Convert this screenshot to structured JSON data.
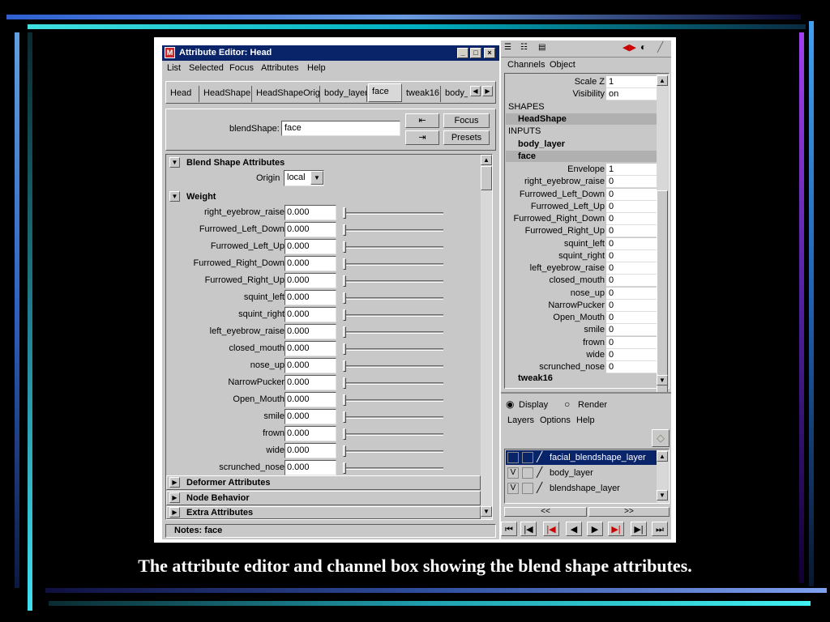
{
  "attribute_editor": {
    "title": "Attribute Editor: Head",
    "menu": [
      "List",
      "Selected",
      "Focus",
      "Attributes",
      "Help"
    ],
    "tabs": [
      "Head",
      "HeadShape",
      "HeadShapeOrig",
      "body_layer",
      "face",
      "tweak16",
      "body_"
    ],
    "active_tab": "face",
    "blendshape_label": "blendShape:",
    "blendshape_value": "face",
    "focus_label": "Focus",
    "presets_label": "Presets",
    "section_blend": "Blend Shape Attributes",
    "origin_label": "Origin",
    "origin_value": "local",
    "section_weight": "Weight",
    "weights": [
      {
        "name": "right_eyebrow_raise",
        "value": "0.000"
      },
      {
        "name": "Furrowed_Left_Down",
        "value": "0.000"
      },
      {
        "name": "Furrowed_Left_Up",
        "value": "0.000"
      },
      {
        "name": "Furrowed_Right_Down",
        "value": "0.000"
      },
      {
        "name": "Furrowed_Right_Up",
        "value": "0.000"
      },
      {
        "name": "squint_left",
        "value": "0.000"
      },
      {
        "name": "squint_right",
        "value": "0.000"
      },
      {
        "name": "left_eyebrow_raise",
        "value": "0.000"
      },
      {
        "name": "closed_mouth",
        "value": "0.000"
      },
      {
        "name": "nose_up",
        "value": "0.000"
      },
      {
        "name": "NarrowPucker",
        "value": "0.000"
      },
      {
        "name": "Open_Mouth",
        "value": "0.000"
      },
      {
        "name": "smile",
        "value": "0.000"
      },
      {
        "name": "frown",
        "value": "0.000"
      },
      {
        "name": "wide",
        "value": "0.000"
      },
      {
        "name": "scrunched_nose",
        "value": "0.000"
      }
    ],
    "section_deformer": "Deformer Attributes",
    "section_node": "Node Behavior",
    "section_extra": "Extra Attributes",
    "notes": "Notes:  face"
  },
  "channel_box": {
    "menu": [
      "Channels",
      "Object"
    ],
    "scale_z": {
      "label": "Scale Z",
      "value": "1"
    },
    "visibility": {
      "label": "Visibility",
      "value": "on"
    },
    "shapes_header": "SHAPES",
    "shape_name": "HeadShape",
    "inputs_header": "INPUTS",
    "input1": "body_layer",
    "input2": "face",
    "channels": [
      {
        "name": "Envelope",
        "value": "1"
      },
      {
        "name": "right_eyebrow_raise",
        "value": "0"
      },
      {
        "name": "Furrowed_Left_Down",
        "value": "0"
      },
      {
        "name": "Furrowed_Left_Up",
        "value": "0"
      },
      {
        "name": "Furrowed_Right_Down",
        "value": "0"
      },
      {
        "name": "Furrowed_Right_Up",
        "value": "0"
      },
      {
        "name": "squint_left",
        "value": "0"
      },
      {
        "name": "squint_right",
        "value": "0"
      },
      {
        "name": "left_eyebrow_raise",
        "value": "0"
      },
      {
        "name": "closed_mouth",
        "value": "0"
      },
      {
        "name": "nose_up",
        "value": "0"
      },
      {
        "name": "NarrowPucker",
        "value": "0"
      },
      {
        "name": "Open_Mouth",
        "value": "0"
      },
      {
        "name": "smile",
        "value": "0"
      },
      {
        "name": "frown",
        "value": "0"
      },
      {
        "name": "wide",
        "value": "0"
      },
      {
        "name": "scrunched_nose",
        "value": "0"
      }
    ],
    "input3": "tweak16"
  },
  "layer_editor": {
    "display_label": "Display",
    "render_label": "Render",
    "menu": [
      "Layers",
      "Options",
      "Help"
    ],
    "layers": [
      {
        "name": "facial_blendshape_layer",
        "v": "",
        "selected": true
      },
      {
        "name": "body_layer",
        "v": "V",
        "selected": false
      },
      {
        "name": "blendshape_layer",
        "v": "V",
        "selected": false
      }
    ],
    "nav_prev": "<<",
    "nav_next": ">>"
  },
  "caption": "The attribute editor and channel box showing the blend shape attributes."
}
